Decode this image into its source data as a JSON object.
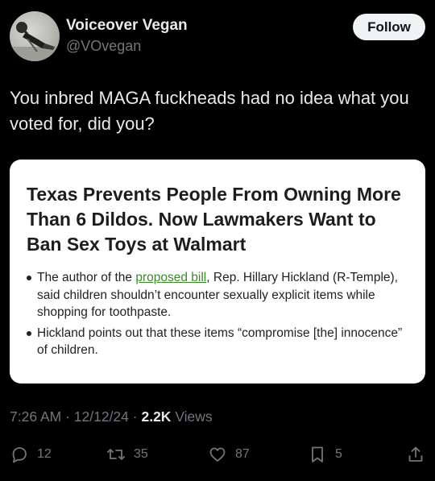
{
  "author": {
    "display_name": "Voiceover Vegan",
    "handle": "@VOvegan",
    "follow_label": "Follow"
  },
  "tweet": {
    "text": "You inbred MAGA fuckheads had no idea what you voted for, did you?"
  },
  "card": {
    "headline": "Texas Prevents People From Owning More Than 6 Dildos. Now Lawmakers Want to Ban Sex Toys at Walmart",
    "bullet1_before": "The author of the ",
    "bullet1_link": "proposed bill",
    "bullet1_after": ", Rep. Hillary Hickland (R-Temple), said children shouldn’t encounter sexually explicit items while shopping for toothpaste.",
    "bullet2": "Hickland points out that these items “compromise [the] innocence” of children."
  },
  "meta": {
    "time": "7:26 AM",
    "date": "12/12/24",
    "separator": " · ",
    "views_count": "2.2K",
    "views_label": "Views"
  },
  "actions": {
    "replies": "12",
    "reposts": "35",
    "likes": "87",
    "bookmarks": "5"
  },
  "icons": [
    "avatar-microphone",
    "reply-icon",
    "repost-icon",
    "like-icon",
    "bookmark-icon",
    "share-icon"
  ],
  "colors": {
    "background": "#000000",
    "primary_text": "#e7e9ea",
    "secondary_text": "#71767b",
    "follow_button": "#eff3f4",
    "link_green": "#3b8a2a"
  }
}
